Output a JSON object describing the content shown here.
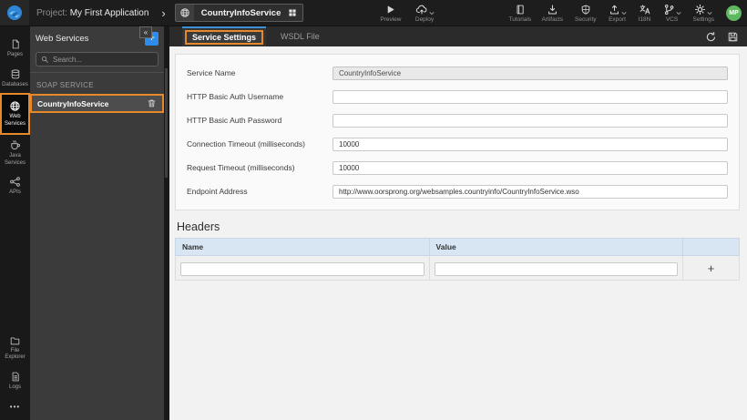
{
  "topbar": {
    "project_label": "Project:",
    "project_name": "My First Application",
    "breadcrumb_chevron": "›",
    "resource_tab": {
      "name": "CountryInfoService",
      "icon": "globe-icon",
      "grid_icon": "grid-icon"
    },
    "actions_left": [
      {
        "label": "Preview",
        "icon": "play-icon",
        "has_caret": false
      },
      {
        "label": "Deploy",
        "icon": "cloud-upload-icon",
        "has_caret": true
      },
      {
        "label": "Tutorials",
        "icon": "book-icon",
        "has_caret": false
      }
    ],
    "actions_right": [
      {
        "label": "Artifacts",
        "icon": "download-icon",
        "has_caret": false
      },
      {
        "label": "Security",
        "icon": "shield-icon",
        "has_caret": false
      },
      {
        "label": "Export",
        "icon": "upload-icon",
        "has_caret": true
      },
      {
        "label": "I18N",
        "icon": "translate-icon",
        "has_caret": false
      },
      {
        "label": "VCS",
        "icon": "branch-icon",
        "has_caret": true
      },
      {
        "label": "Settings",
        "icon": "gear-icon",
        "has_caret": true
      }
    ],
    "avatar_initials": "MP"
  },
  "sidebar": {
    "items": [
      {
        "label": "Pages",
        "icon": "page-icon",
        "active": false
      },
      {
        "label": "Databases",
        "icon": "database-icon",
        "active": false
      },
      {
        "label": "Web Services",
        "icon": "globe-icon",
        "active": true
      },
      {
        "label": "Java Services",
        "icon": "coffee-icon",
        "active": false
      },
      {
        "label": "APIs",
        "icon": "api-icon",
        "active": false
      }
    ],
    "bottom_items": [
      {
        "label": "File Explorer",
        "icon": "folder-icon"
      },
      {
        "label": "Logs",
        "icon": "log-file-icon"
      }
    ],
    "more_label": "•••"
  },
  "panel": {
    "title": "Web Services",
    "add_button": "+",
    "collapse_button": "«",
    "search_placeholder": "Search...",
    "section_label": "SOAP SERVICE",
    "items": [
      {
        "name": "CountryInfoService",
        "selected": true,
        "trash_icon": "trash-icon"
      }
    ]
  },
  "content": {
    "tabs": [
      {
        "label": "Service Settings",
        "active": true
      },
      {
        "label": "WSDL File",
        "active": false
      }
    ],
    "toolbar": {
      "refresh_icon": "refresh-icon",
      "save_icon": "save-icon"
    },
    "form": {
      "fields": [
        {
          "label": "Service Name",
          "value": "CountryInfoService",
          "disabled": true
        },
        {
          "label": "HTTP Basic Auth Username",
          "value": ""
        },
        {
          "label": "HTTP Basic Auth Password",
          "value": ""
        },
        {
          "label": "Connection Timeout (milliseconds)",
          "value": "10000"
        },
        {
          "label": "Request Timeout (milliseconds)",
          "value": "10000"
        },
        {
          "label": "Endpoint Address",
          "value": "http://www.oorsprong.org/websamples.countryinfo/CountryInfoService.wso"
        }
      ]
    },
    "headers_section": {
      "title": "Headers",
      "columns": [
        "Name",
        "Value"
      ],
      "rows": [
        {
          "name": "",
          "value": ""
        }
      ],
      "add_row_label": "+"
    }
  },
  "colors": {
    "annotation_orange": "#e8882c",
    "accent_blue": "#2e8ced",
    "active_tab_top_border": "#3f8fd6",
    "avatar_green": "#5fb760",
    "table_header_bg": "#d8e6f4"
  }
}
